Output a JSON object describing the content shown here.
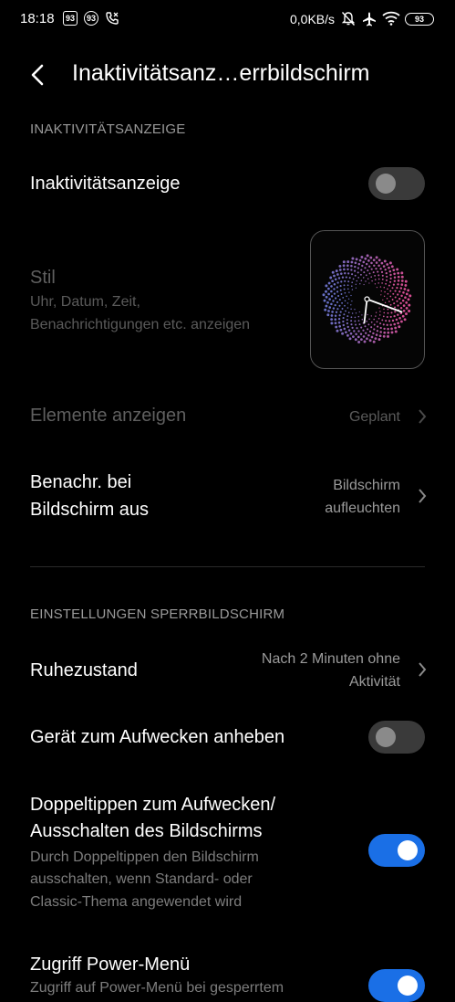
{
  "status": {
    "time": "18:18",
    "badge1": "93",
    "badge2": "93",
    "speed": "0,0KB/s",
    "battery": "93"
  },
  "header": {
    "title": "Inaktivitätsanz…errbildschirm"
  },
  "section1": {
    "title": "INAKTIVITÄTSANZEIGE"
  },
  "aod": {
    "label": "Inaktivitätsanzeige",
    "toggle_on": false
  },
  "style": {
    "label": "Stil",
    "description_line1": "Uhr, Datum, Zeit,",
    "description_line2": "Benachrichtigungen etc. anzeigen"
  },
  "elements": {
    "label": "Elemente anzeigen",
    "value": "Geplant"
  },
  "notify": {
    "label_line1": "Benachr. bei",
    "label_line2": "Bildschirm aus",
    "value_line1": "Bildschirm",
    "value_line2": "aufleuchten"
  },
  "section2": {
    "title": "EINSTELLUNGEN SPERRBILDSCHIRM"
  },
  "sleep": {
    "label": "Ruhezustand",
    "value_line1": "Nach 2 Minuten ohne",
    "value_line2": "Aktivität"
  },
  "raise": {
    "label": "Gerät zum Aufwecken anheben",
    "toggle_on": false
  },
  "doubletap": {
    "label_line1": "Doppeltippen zum Aufwecken/",
    "label_line2": "Ausschalten des Bildschirms",
    "desc_line1": "Durch Doppeltippen den Bildschirm",
    "desc_line2": "ausschalten, wenn Standard- oder",
    "desc_line3": "Classic-Thema angewendet wird",
    "toggle_on": true
  },
  "power": {
    "label": "Zugriff Power-Menü",
    "desc_partial": "Zugriff auf Power-Menü bei gesperrtem",
    "toggle_on": true
  },
  "colors": {
    "accent": "#1a6fe6",
    "background": "#000000"
  }
}
